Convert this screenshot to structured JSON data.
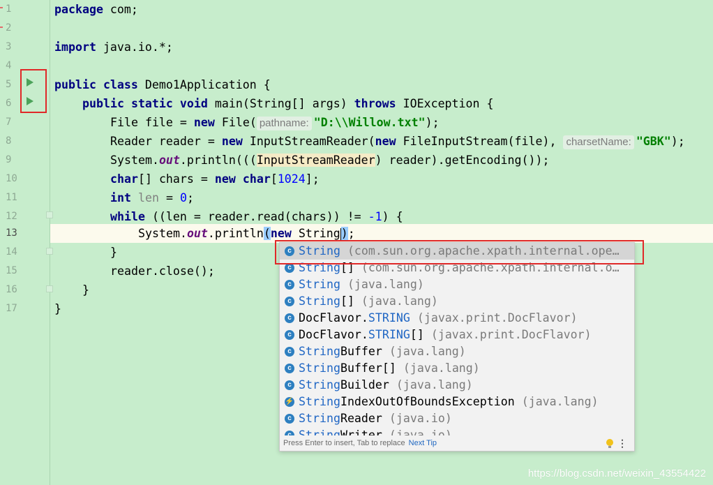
{
  "code": {
    "l1_kw": "package",
    "l1_rest": " com;",
    "l3_kw": "import",
    "l3_rest": " java.io.*;",
    "l5_kw1": "public",
    "l5_kw2": "class",
    "l5_rest": " Demo1Application {",
    "l6_kw1": "public",
    "l6_kw2": "static",
    "l6_kw3": "void",
    "l6_rest1": " main(String[] args) ",
    "l6_kw4": "throws",
    "l6_rest2": " IOException {",
    "l7_a": "File file = ",
    "l7_kw": "new",
    "l7_b": " File(",
    "l7_hint": "pathname:",
    "l7_str": "\"D:\\\\Willow.txt\"",
    "l7_c": ");",
    "l8_a": "Reader reader = ",
    "l8_kw1": "new",
    "l8_b": " InputStreamReader(",
    "l8_kw2": "new",
    "l8_c": " FileInputStream(file), ",
    "l8_hint": "charsetName:",
    "l8_str": "\"GBK\"",
    "l8_d": ");",
    "l9_a": "System.",
    "l9_fld": "out",
    "l9_b": ".println(((",
    "l9_cast": "InputStreamReader",
    "l9_c": ") reader).getEncoding());",
    "l10_kw1": "char",
    "l10_a": "[] chars = ",
    "l10_kw2": "new",
    "l10_kw3": " char",
    "l10_b": "[",
    "l10_num": "1024",
    "l10_c": "];",
    "l11_kw": "int",
    "l11_unused": " len",
    "l11_a": " = ",
    "l11_num": "0",
    "l11_b": ";",
    "l12_kw": "while",
    "l12_a": " ((len = reader.read(chars)) != ",
    "l12_num": "-1",
    "l12_b": ") {",
    "l13_a": "System.",
    "l13_fld": "out",
    "l13_b": ".println",
    "l13_paren": "(",
    "l13_kw": "new",
    "l13_c": " String",
    "l13_paren2": ")",
    "l13_d": ";",
    "l14": "}",
    "l15": "reader.close();",
    "l16": "}",
    "l17": "}"
  },
  "line_numbers": [
    "1",
    "2",
    "3",
    "4",
    "5",
    "6",
    "7",
    "8",
    "9",
    "10",
    "11",
    "12",
    "13",
    "14",
    "15",
    "16",
    "17"
  ],
  "completion": {
    "items": [
      {
        "icon": "c",
        "match": "String",
        "name_rest": "",
        "pkg": " (com.sun.org.apache.xpath.internal.ope…"
      },
      {
        "icon": "c",
        "match": "String",
        "name_rest": "[]",
        "pkg": " (com.sun.org.apache.xpath.internal.o…"
      },
      {
        "icon": "c",
        "match": "String",
        "name_rest": "",
        "pkg": " (java.lang)"
      },
      {
        "icon": "c",
        "match": "String",
        "name_rest": "[]",
        "pkg": " (java.lang)"
      },
      {
        "icon": "c",
        "match_pre": "DocFlavor.",
        "match": "STRING",
        "name_rest": "",
        "pkg": " (javax.print.DocFlavor)"
      },
      {
        "icon": "c",
        "match_pre": "DocFlavor.",
        "match": "STRING",
        "name_rest": "[]",
        "pkg": " (javax.print.DocFlavor)"
      },
      {
        "icon": "c",
        "match": "String",
        "name_rest": "Buffer",
        "pkg": " (java.lang)"
      },
      {
        "icon": "c",
        "match": "String",
        "name_rest": "Buffer[]",
        "pkg": " (java.lang)"
      },
      {
        "icon": "c",
        "match": "String",
        "name_rest": "Builder",
        "pkg": " (java.lang)"
      },
      {
        "icon": "e",
        "match": "String",
        "name_rest": "IndexOutOfBoundsException",
        "pkg": " (java.lang)"
      },
      {
        "icon": "c",
        "match": "String",
        "name_rest": "Reader",
        "pkg": " (java.io)"
      },
      {
        "icon": "c",
        "match": "String",
        "name_rest": "Writer",
        "pkg": " (java.io)"
      }
    ],
    "footer_tip": "Press Enter to insert, Tab to replace",
    "footer_link": "Next Tip"
  },
  "watermark": "https://blog.csdn.net/weixin_43554422",
  "colors": {
    "background": "#C7EDCC",
    "keyword": "#000080",
    "string": "#008000",
    "match": "#2167C4",
    "annotation": "#E02828"
  }
}
